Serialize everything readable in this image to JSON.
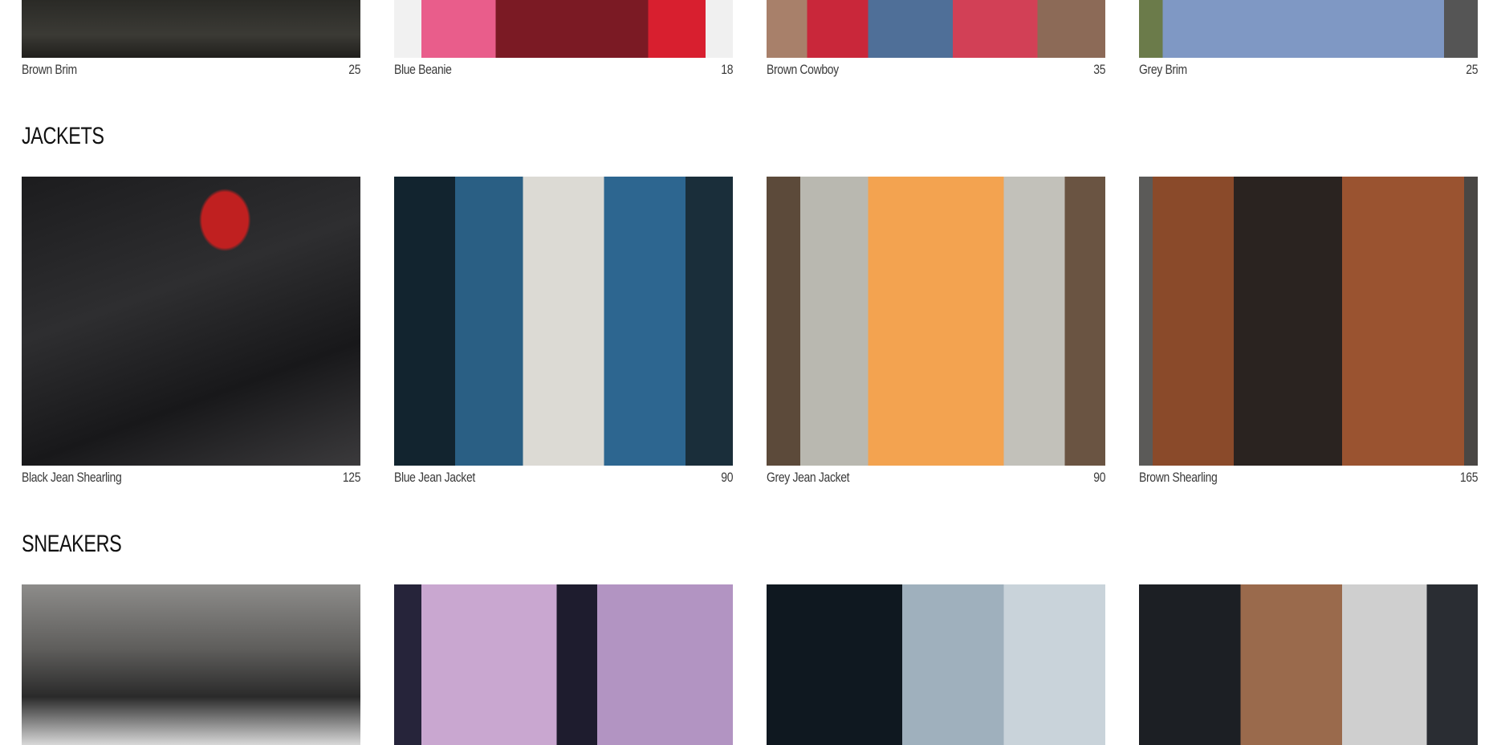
{
  "sections": [
    {
      "title": "",
      "items": [
        {
          "name": "Brown Brim",
          "price": "25"
        },
        {
          "name": "Blue Beanie",
          "price": "18"
        },
        {
          "name": "Brown Cowboy",
          "price": "35"
        },
        {
          "name": "Grey Brim",
          "price": "25"
        }
      ]
    },
    {
      "title": "JACKETS",
      "items": [
        {
          "name": "Black Jean Shearling",
          "price": "125"
        },
        {
          "name": "Blue Jean Jacket",
          "price": "90"
        },
        {
          "name": "Grey Jean Jacket",
          "price": "90"
        },
        {
          "name": "Brown Shearling",
          "price": "165"
        }
      ]
    },
    {
      "title": "SNEAKERS",
      "items": [
        {
          "name": "",
          "price": ""
        },
        {
          "name": "",
          "price": ""
        },
        {
          "name": "",
          "price": ""
        },
        {
          "name": "",
          "price": ""
        }
      ]
    }
  ]
}
